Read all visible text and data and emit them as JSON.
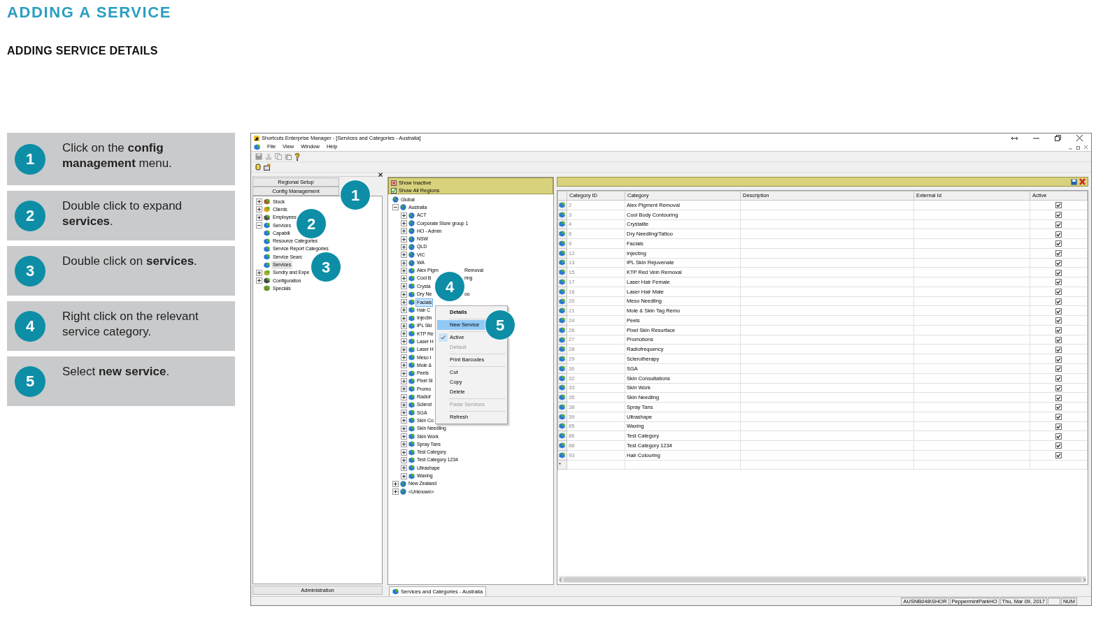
{
  "page": {
    "title": "ADDING A SERVICE",
    "subtitle": "ADDING SERVICE DETAILS"
  },
  "steps": [
    {
      "number": "1",
      "text": "Click on the **config management** menu."
    },
    {
      "number": "2",
      "text": "Double click to expand **services**."
    },
    {
      "number": "3",
      "text": "Double click on **services**."
    },
    {
      "number": "4",
      "text": "Right click on the relevant service category."
    },
    {
      "number": "5",
      "text": "Select **new service**."
    }
  ],
  "app": {
    "window": {
      "title": "Shortcuts Enterprise Manager - [Services and Categories - Australia]"
    },
    "menu": [
      "File",
      "View",
      "Window",
      "Help"
    ],
    "nav_panel": {
      "sections": [
        "Regional Setup",
        "Config Management"
      ],
      "tree": [
        {
          "label": "Stock",
          "expanded": false,
          "selected": false
        },
        {
          "label": "Clients",
          "expanded": false,
          "selected": false
        },
        {
          "label": "Employees",
          "expanded": false,
          "selected": false
        },
        {
          "label": "Services",
          "expanded": true,
          "selected": false,
          "children": [
            {
              "label": "Capabili",
              "selected": false
            },
            {
              "label": "Resource Categories",
              "selected": false
            },
            {
              "label": "Service Report Categories",
              "selected": false
            },
            {
              "label": "Service Searc",
              "selected": false
            },
            {
              "label": "Services",
              "selected": true
            }
          ]
        },
        {
          "label": "Sundry and Expe",
          "expanded": false,
          "selected": false
        },
        {
          "label": "Configuration",
          "expanded": false,
          "selected": false
        },
        {
          "label": "Specials",
          "selected": false
        }
      ],
      "footer": "Administration"
    },
    "region_panel": {
      "filters": [
        {
          "label": "Show Inactive",
          "checked": false
        },
        {
          "label": "Show All Regions",
          "checked": true
        }
      ],
      "tree": [
        {
          "label": "Global",
          "kind": "region",
          "selected": false,
          "children": [
            {
              "label": "Australia",
              "kind": "region",
              "expanded": true,
              "selected": false,
              "children": [
                {
                  "label": "ACT",
                  "kind": "region",
                  "expanded": false,
                  "selected": false
                },
                {
                  "label": "Corporate Store group 1",
                  "kind": "region",
                  "expanded": false,
                  "selected": false
                },
                {
                  "label": "HO - Admin",
                  "kind": "region",
                  "expanded": false,
                  "selected": false
                },
                {
                  "label": "NSW",
                  "kind": "region",
                  "expanded": false,
                  "selected": false
                },
                {
                  "label": "QLD",
                  "kind": "region",
                  "expanded": false,
                  "selected": false
                },
                {
                  "label": "VIC",
                  "kind": "region",
                  "expanded": false,
                  "selected": false
                },
                {
                  "label": "WA",
                  "kind": "region",
                  "expanded": false,
                  "selected": false
                },
                {
                  "label": "Alex Pigm",
                  "tail": "Removal",
                  "kind": "category",
                  "expanded": false,
                  "selected": false
                },
                {
                  "label": "Cool B",
                  "tail": "ring",
                  "kind": "category",
                  "expanded": false,
                  "selected": false
                },
                {
                  "label": "Crysta",
                  "kind": "category",
                  "expanded": false,
                  "selected": false
                },
                {
                  "label": "Dry Ne",
                  "tail": "oo",
                  "kind": "category",
                  "expanded": false,
                  "selected": false
                },
                {
                  "label": "Facials",
                  "kind": "category",
                  "expanded": false,
                  "selected": true
                },
                {
                  "label": "Hair C",
                  "kind": "category",
                  "expanded": false,
                  "selected": false
                },
                {
                  "label": "Injectin",
                  "kind": "category",
                  "expanded": false,
                  "selected": false
                },
                {
                  "label": "IPL Ski",
                  "kind": "category",
                  "expanded": false,
                  "selected": false
                },
                {
                  "label": "KTP Re",
                  "kind": "category",
                  "expanded": false,
                  "selected": false
                },
                {
                  "label": "Laser H",
                  "kind": "category",
                  "expanded": false,
                  "selected": false
                },
                {
                  "label": "Laser H",
                  "kind": "category",
                  "expanded": false,
                  "selected": false
                },
                {
                  "label": "Meso I",
                  "kind": "category",
                  "expanded": false,
                  "selected": false
                },
                {
                  "label": "Mole &",
                  "kind": "category",
                  "expanded": false,
                  "selected": false
                },
                {
                  "label": "Peels",
                  "kind": "category",
                  "expanded": false,
                  "selected": false
                },
                {
                  "label": "Pixel Sl",
                  "kind": "category",
                  "expanded": false,
                  "selected": false
                },
                {
                  "label": "Promo",
                  "kind": "category",
                  "expanded": false,
                  "selected": false
                },
                {
                  "label": "Radiof",
                  "kind": "category",
                  "expanded": false,
                  "selected": false
                },
                {
                  "label": "Sclerot",
                  "kind": "category",
                  "expanded": false,
                  "selected": false
                },
                {
                  "label": "SGA",
                  "kind": "category",
                  "expanded": false,
                  "selected": false
                },
                {
                  "label": "Skin Co",
                  "kind": "category",
                  "expanded": false,
                  "selected": false
                },
                {
                  "label": "Skin Needling",
                  "kind": "category",
                  "expanded": false,
                  "selected": false
                },
                {
                  "label": "Skin Work",
                  "kind": "category",
                  "expanded": false,
                  "selected": false
                },
                {
                  "label": "Spray Tans",
                  "kind": "category",
                  "expanded": false,
                  "selected": false
                },
                {
                  "label": "Test Category",
                  "kind": "category",
                  "expanded": false,
                  "selected": false
                },
                {
                  "label": "Test Category 1234",
                  "kind": "category",
                  "expanded": false,
                  "selected": false
                },
                {
                  "label": "Ultrashape",
                  "kind": "category",
                  "expanded": false,
                  "selected": false
                },
                {
                  "label": "Waxing",
                  "kind": "category",
                  "expanded": false,
                  "selected": false
                }
              ]
            },
            {
              "label": "New Zealand",
              "kind": "region",
              "expanded": false,
              "selected": false
            },
            {
              "label": "<Unknown>",
              "kind": "region",
              "expanded": false,
              "selected": false
            }
          ]
        }
      ]
    },
    "context_menu": [
      {
        "kind": "item",
        "label": "Details",
        "bold": true,
        "selected": false,
        "checked": false,
        "disabled": false
      },
      {
        "kind": "separator"
      },
      {
        "kind": "item",
        "label": "New Service",
        "bold": false,
        "selected": true,
        "checked": false,
        "disabled": false
      },
      {
        "kind": "separator"
      },
      {
        "kind": "item",
        "label": "Active",
        "bold": false,
        "selected": false,
        "checked": true,
        "disabled": false
      },
      {
        "kind": "item",
        "label": "Default",
        "bold": false,
        "selected": false,
        "checked": false,
        "disabled": true
      },
      {
        "kind": "separator"
      },
      {
        "kind": "item",
        "label": "Print Barcodes",
        "bold": false,
        "selected": false,
        "checked": false,
        "disabled": false
      },
      {
        "kind": "separator"
      },
      {
        "kind": "item",
        "label": "Cut",
        "bold": false,
        "selected": false,
        "checked": false,
        "disabled": false
      },
      {
        "kind": "item",
        "label": "Copy",
        "bold": false,
        "selected": false,
        "checked": false,
        "disabled": false
      },
      {
        "kind": "item",
        "label": "Delete",
        "bold": false,
        "selected": false,
        "checked": false,
        "disabled": false
      },
      {
        "kind": "separator"
      },
      {
        "kind": "item",
        "label": "Paste Services",
        "bold": false,
        "selected": false,
        "checked": false,
        "disabled": true
      },
      {
        "kind": "separator"
      },
      {
        "kind": "item",
        "label": "Refresh",
        "bold": false,
        "selected": false,
        "checked": false,
        "disabled": false
      }
    ],
    "table": {
      "columns": [
        "Category ID",
        "Category",
        "Description",
        "External Id",
        "Active"
      ],
      "rows": [
        {
          "id": "2",
          "category": "Alex Pigment Removal",
          "active": true
        },
        {
          "id": "3",
          "category": "Cool Body Contouring",
          "active": true
        },
        {
          "id": "4",
          "category": "Crystalite",
          "active": true
        },
        {
          "id": "6",
          "category": "Dry Needling/Tattoo",
          "active": true
        },
        {
          "id": "9",
          "category": "Facials",
          "active": true
        },
        {
          "id": "12",
          "category": "Injecting",
          "active": true
        },
        {
          "id": "13",
          "category": "IPL Skin Rejuvenate",
          "active": true
        },
        {
          "id": "15",
          "category": "KTP Red Vein Removal",
          "active": true
        },
        {
          "id": "17",
          "category": "Laser Hair Female",
          "active": true
        },
        {
          "id": "18",
          "category": "Laser Hair Male",
          "active": true
        },
        {
          "id": "20",
          "category": "Meso Needling",
          "active": true
        },
        {
          "id": "21",
          "category": "Mole & Skin Tag Remo",
          "active": true
        },
        {
          "id": "24",
          "category": "Peels",
          "active": true
        },
        {
          "id": "26",
          "category": "Pixel Skin Resurface",
          "active": true
        },
        {
          "id": "27",
          "category": "Promotions",
          "active": true
        },
        {
          "id": "28",
          "category": "Radiofrequency",
          "active": true
        },
        {
          "id": "29",
          "category": "Sclerotherapy",
          "active": true
        },
        {
          "id": "30",
          "category": "SGA",
          "active": true
        },
        {
          "id": "32",
          "category": "Skin Consultations",
          "active": true
        },
        {
          "id": "33",
          "category": "Skin Work",
          "active": true
        },
        {
          "id": "35",
          "category": "Skin Needling",
          "active": true
        },
        {
          "id": "38",
          "category": "Spray Tans",
          "active": true
        },
        {
          "id": "39",
          "category": "Ultrashape",
          "active": true
        },
        {
          "id": "85",
          "category": "Waxing",
          "active": true
        },
        {
          "id": "86",
          "category": "Test Category",
          "active": true
        },
        {
          "id": "88",
          "category": "Test Category 1234",
          "active": true
        },
        {
          "id": "93",
          "category": "Hair Colouring",
          "active": true
        }
      ],
      "new_row_marker": "*"
    },
    "document_tab": "Services and Categories - Australia",
    "status_bar": [
      "AUSNB048\\SHOR",
      "PeppermintParkHO",
      "Thu, Mar 09, 2017",
      "NUM"
    ]
  },
  "callouts": [
    {
      "number": "1"
    },
    {
      "number": "2"
    },
    {
      "number": "3"
    },
    {
      "number": "4"
    },
    {
      "number": "5"
    }
  ]
}
